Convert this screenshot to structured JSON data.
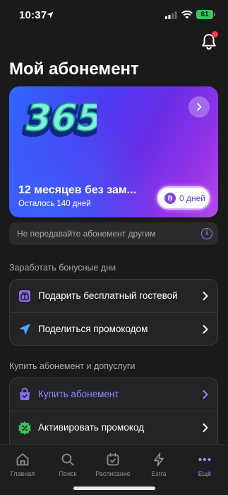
{
  "status": {
    "time": "10:37",
    "battery": "61"
  },
  "page": {
    "title": "Мой абонемент"
  },
  "card": {
    "title": "12 месяцев без зам...",
    "subtitle": "Осталось 140 дней",
    "days_badge": "0 дней",
    "days_icon_letter": "B",
    "logo_text": "365"
  },
  "warning": {
    "text": "Не передавайте абонемент другим"
  },
  "section_bonus": {
    "title": "Заработать бонусные дни",
    "items": [
      {
        "label": "Подарить бесплатный гостевой",
        "icon": "gift-icon"
      },
      {
        "label": "Поделиться промокодом",
        "icon": "send-icon"
      }
    ]
  },
  "section_buy": {
    "title": "Купить абонемент и допуслуги",
    "items": [
      {
        "label": "Купить абонемент",
        "icon": "shopping-bag-icon"
      },
      {
        "label": "Активировать промокод",
        "icon": "percent-icon"
      }
    ]
  },
  "tabs": [
    {
      "label": "Главная",
      "icon": "home-icon"
    },
    {
      "label": "Поиск",
      "icon": "search-icon"
    },
    {
      "label": "Расписание",
      "icon": "calendar-icon"
    },
    {
      "label": "Extra",
      "icon": "lightning-icon"
    },
    {
      "label": "Ещё",
      "icon": "more-icon",
      "active": true
    }
  ],
  "colors": {
    "accent": "#8b8dff",
    "background": "#1a1a1c",
    "notification_dot": "#ff3b4a"
  }
}
